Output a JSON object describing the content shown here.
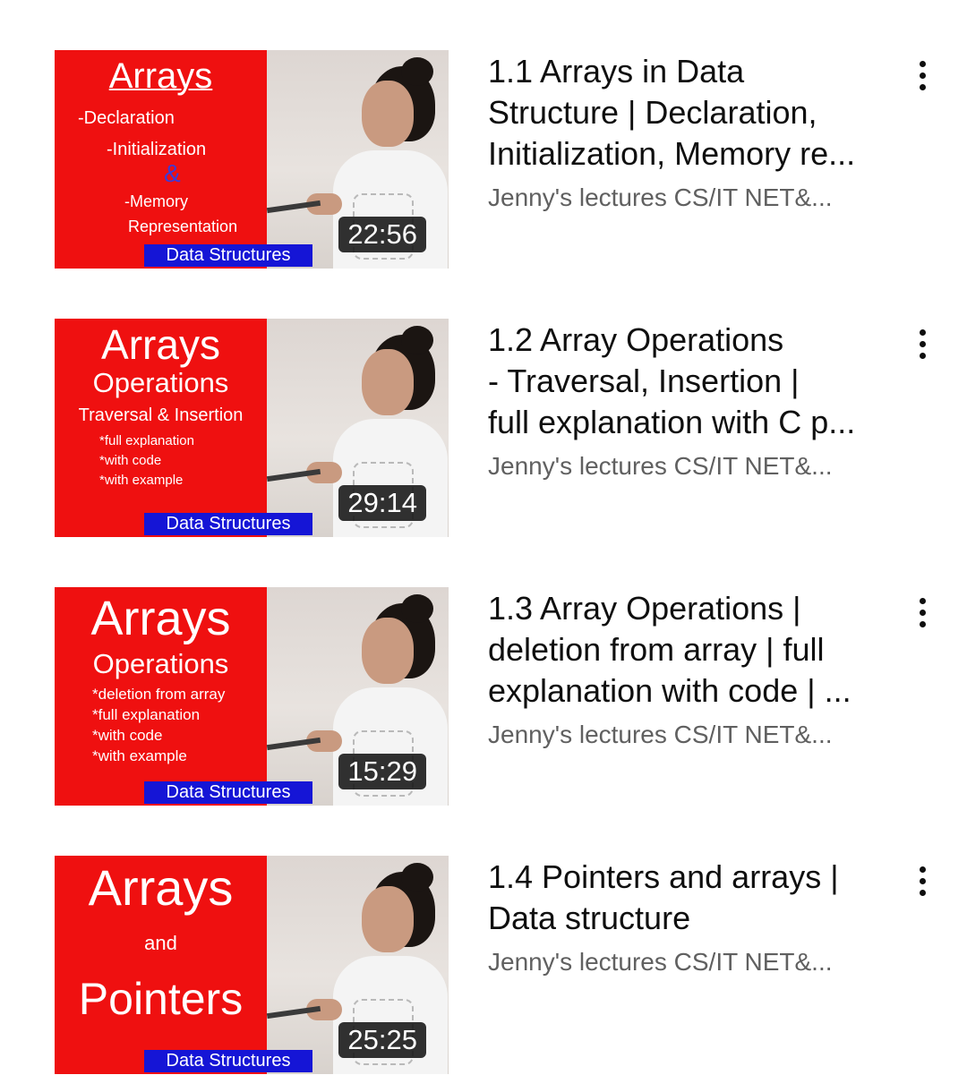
{
  "videos": [
    {
      "title_lines": [
        "1.1 Arrays in Data",
        "Structure | Declaration,",
        "Initialization, Memory re..."
      ],
      "channel": "Jenny's lectures CS/IT NET&...",
      "duration": "22:56",
      "thumb": {
        "title": "Arrays",
        "lines": [
          "-Declaration",
          "-Initialization",
          "&",
          "-Memory",
          "Representation"
        ],
        "badge": "Data Structures"
      }
    },
    {
      "title_lines": [
        "1.2 Array Operations",
        "- Traversal, Insertion |",
        "full explanation with C p..."
      ],
      "channel": "Jenny's lectures CS/IT NET&...",
      "duration": "29:14",
      "thumb": {
        "title": "Arrays",
        "subtitle": "Operations",
        "line": "Traversal & Insertion",
        "bullets": [
          "*full explanation",
          "*with code",
          "*with example"
        ],
        "badge": "Data Structures"
      }
    },
    {
      "title_lines": [
        "1.3 Array Operations |",
        "deletion from array | full",
        "explanation with code | ..."
      ],
      "channel": "Jenny's lectures CS/IT NET&...",
      "duration": "15:29",
      "thumb": {
        "title": "Arrays",
        "subtitle": "Operations",
        "bullets": [
          "*deletion from array",
          "*full explanation",
          "*with code",
          "*with example"
        ],
        "badge": "Data Structures"
      }
    },
    {
      "title_lines": [
        "1.4 Pointers and arrays |",
        "Data structure"
      ],
      "channel": "Jenny's lectures CS/IT NET&...",
      "duration": "25:25",
      "thumb": {
        "title": "Arrays",
        "middle": "and",
        "bottom": "Pointers",
        "badge": "Data Structures"
      }
    }
  ]
}
